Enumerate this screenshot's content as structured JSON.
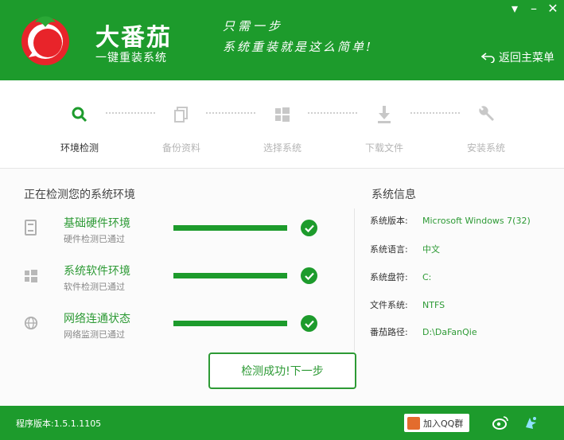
{
  "header": {
    "app_name": "大番茄",
    "app_sub": "一键重装系统",
    "slogan_line1": "只需一步",
    "slogan_line2": "系统重装就是这么简单!",
    "back_menu": "返回主菜单",
    "controls": {
      "menu": "▾",
      "minimize": "–",
      "close": "✕"
    }
  },
  "steps": [
    {
      "label": "环境检测",
      "icon": "search-icon",
      "active": true
    },
    {
      "label": "备份资料",
      "icon": "copy-icon",
      "active": false
    },
    {
      "label": "选择系统",
      "icon": "windows-icon",
      "active": false
    },
    {
      "label": "下载文件",
      "icon": "download-icon",
      "active": false
    },
    {
      "label": "安装系统",
      "icon": "wrench-icon",
      "active": false
    }
  ],
  "check": {
    "title": "正在检测您的系统环境",
    "items": [
      {
        "title": "基础硬件环境",
        "sub": "硬件检测已通过",
        "icon": "hardware-icon",
        "progress": 1.0
      },
      {
        "title": "系统软件环境",
        "sub": "软件检测已通过",
        "icon": "windows-icon",
        "progress": 1.0
      },
      {
        "title": "网络连通状态",
        "sub": "网络监测已通过",
        "icon": "globe-icon",
        "progress": 1.0
      }
    ]
  },
  "sysinfo": {
    "title": "系统信息",
    "rows": [
      {
        "label": "系统版本:",
        "value": "Microsoft Windows 7(32)"
      },
      {
        "label": "系统语言:",
        "value": "中文"
      },
      {
        "label": "系统盘符:",
        "value": "C:"
      },
      {
        "label": "文件系统:",
        "value": "NTFS"
      },
      {
        "label": "番茄路径:",
        "value": "D:\\DaFanQie"
      }
    ]
  },
  "next_button": "检测成功!下一步",
  "footer": {
    "version": "程序版本:1.5.1.1105",
    "qq_group": "加入QQ群"
  },
  "colors": {
    "brand": "#1d9b2c",
    "accent_text": "#2d9a35"
  }
}
